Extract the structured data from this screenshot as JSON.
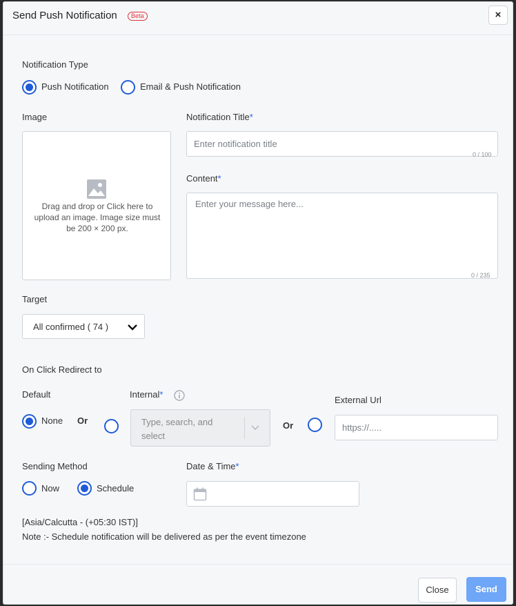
{
  "header": {
    "title": "Send Push Notification",
    "badge": "Beta",
    "close_glyph": "×"
  },
  "notification_type": {
    "label": "Notification Type",
    "options": [
      {
        "label": "Push Notification",
        "selected": true
      },
      {
        "label": "Email & Push Notification",
        "selected": false
      }
    ]
  },
  "image": {
    "label": "Image",
    "dropzone_text": "Drag and drop or Click here to upload an image. Image size must be 200 × 200 px.",
    "icon": "image-icon"
  },
  "title_field": {
    "label": "Notification Title",
    "required_mark": "*",
    "placeholder": "Enter notification title",
    "value": "",
    "counter": "0 / 100"
  },
  "content_field": {
    "label": "Content",
    "required_mark": "*",
    "placeholder": "Enter your message here...",
    "value": "",
    "counter": "0 / 235"
  },
  "target": {
    "label": "Target",
    "selected": "All confirmed ( 74 )",
    "icon": "chevron-down-icon"
  },
  "redirect": {
    "label": "On Click Redirect to",
    "default_label": "Default",
    "none_label": "None",
    "none_selected": true,
    "or": "Or",
    "internal_label": "Internal",
    "internal_required": "*",
    "internal_placeholder": "Type, search, and select",
    "internal_selected": false,
    "external_label": "External Url",
    "external_placeholder": "https://.....",
    "external_selected": false
  },
  "sending": {
    "label": "Sending Method",
    "now_label": "Now",
    "now_selected": false,
    "schedule_label": "Schedule",
    "schedule_selected": true,
    "datetime_label": "Date & Time",
    "datetime_required": "*",
    "datetime_value": ""
  },
  "timezone": "[Asia/Calcutta - (+05:30 IST)]",
  "note": "Note :- Schedule notification will be delivered as per the event timezone",
  "footer": {
    "close_label": "Close",
    "send_label": "Send"
  },
  "colors": {
    "accent": "#1f5bd8",
    "send_button": "#6ea6f8",
    "beta_badge": "#e0323a"
  }
}
